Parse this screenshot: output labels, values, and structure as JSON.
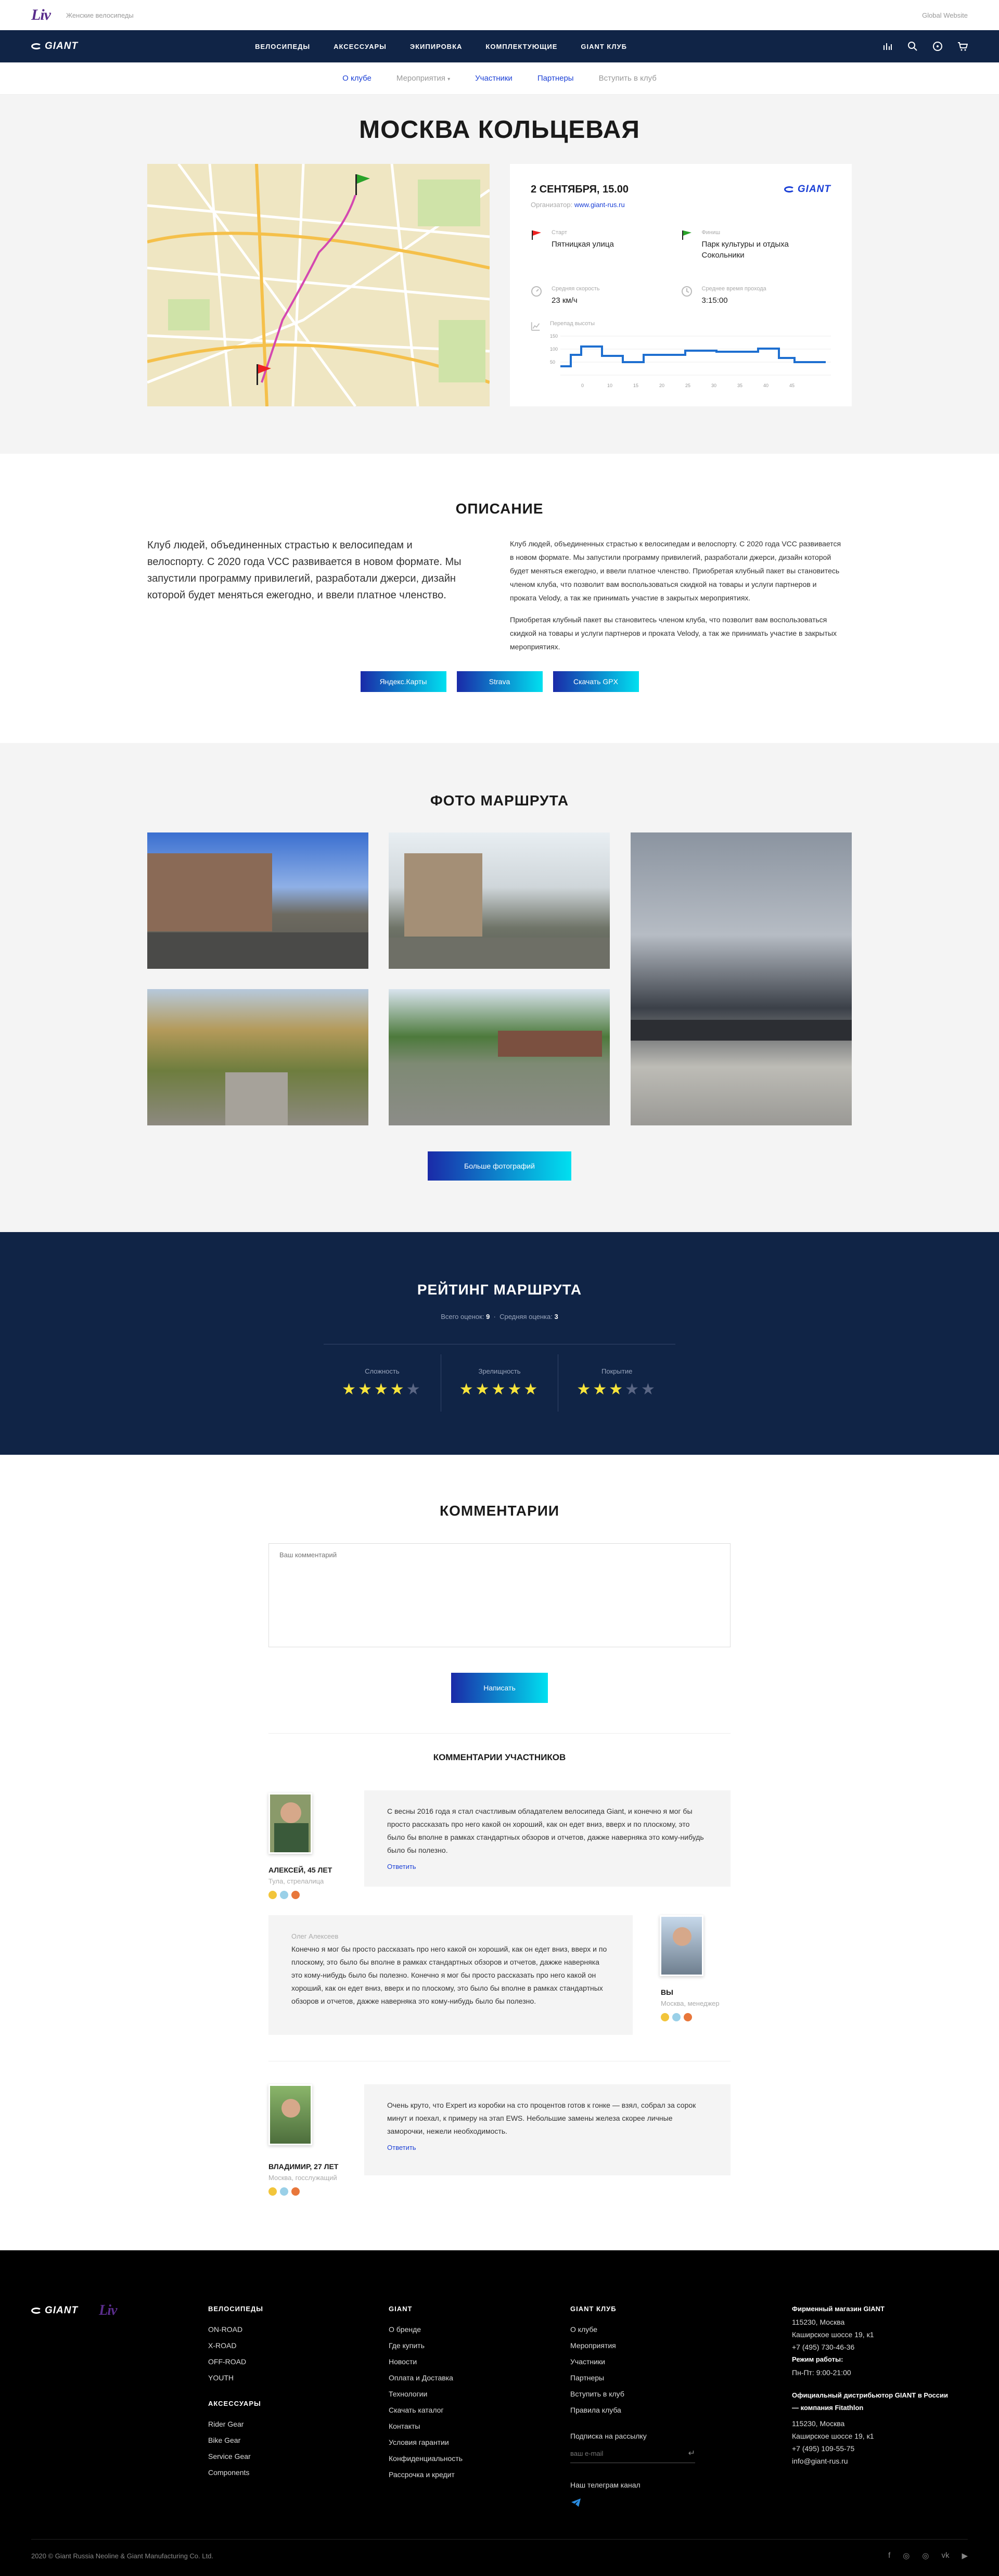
{
  "topbar": {
    "sub_brand": "Женские велосипеды",
    "global": "Global Website"
  },
  "nav": {
    "items": [
      "ВЕЛОСИПЕДЫ",
      "АКСЕССУАРЫ",
      "ЭКИПИРОВКА",
      "КОМПЛЕКТУЮЩИЕ",
      "GIANT КЛУБ"
    ]
  },
  "subnav": {
    "items": [
      "О клубе",
      "Мероприятия",
      "Участники",
      "Партнеры",
      "Вступить в клуб"
    ]
  },
  "route": {
    "title": "МОСКВА КОЛЬЦЕВАЯ",
    "date": "2 СЕНТЯБРЯ, 15.00",
    "organizer_label": "Организатор:",
    "organizer_link": "www.giant-rus.ru",
    "start_label": "Старт",
    "start": "Пятницкая улица",
    "finish_label": "Финиш",
    "finish": "Парк культуры и отдыха Сокольники",
    "speed_label": "Средняя скорость",
    "speed": "23 км/ч",
    "time_label": "Среднее время прохода",
    "time": "3:15:00",
    "elevation_label": "Перепад высоты",
    "elev_y_ticks": [
      "150",
      "100",
      "50"
    ],
    "elev_x_ticks": [
      "0",
      "10",
      "15",
      "20",
      "25",
      "30",
      "35",
      "40",
      "45"
    ]
  },
  "description": {
    "title": "ОПИСАНИЕ",
    "lead": "Клуб людей, объединенных страстью к велосипедам и велоспорту. С 2020 года VCC развивается в новом формате. Мы запустили программу привилегий, разработали джерси, дизайн которой будет меняться ежегодно, и ввели платное членство.",
    "p1": "Клуб людей, объединенных страстью к велосипедам и велоспорту. С 2020 года VCC развивается в новом формате. Мы запустили программу привилегий, разработали джерси, дизайн которой будет меняться ежегодно, и ввели платное членство. Приобретая клубный пакет вы становитесь членом клуба, что позволит вам воспользоваться скидкой на товары и услуги партнеров и проката Velody, а так же принимать участие в закрытых мероприятиях.",
    "p2": "Приобретая клубный пакет вы становитесь членом клуба, что позволит вам воспользоваться скидкой на товары и услуги партнеров и проката Velody, а так же принимать участие в закрытых мероприятиях.",
    "buttons": [
      "Яндекс.Карты",
      "Strava",
      "Скачать GPX"
    ]
  },
  "photos": {
    "title": "ФОТО МАРШРУТА",
    "more": "Больше фотографий"
  },
  "rating": {
    "title": "РЕЙТИНГ МАРШРУТА",
    "total_label": "Всего оценок:",
    "total": "9",
    "avg_label": "Средняя оценка:",
    "avg": "3",
    "criteria": [
      {
        "label": "Сложность",
        "stars": 4
      },
      {
        "label": "Зрелищность",
        "stars": 5
      },
      {
        "label": "Покрытие",
        "stars": 3
      }
    ]
  },
  "comments": {
    "title": "КОММЕНТАРИИ",
    "placeholder": "Ваш комментарий",
    "submit": "Написать",
    "list_title": "КОММЕНТАРИИ УЧАСТНИКОВ",
    "reply": "Ответить",
    "items": [
      {
        "name": "АЛЕКСЕЙ, 45 ЛЕТ",
        "sub": "Тула, стрелалица",
        "text": "С весны 2016 года я стал счастливым обладателем велосипеда Giant, и конечно я мог бы просто рассказать про него какой он хороший, как он едет вниз, вверх и по плоскому, это было бы вполне в рамках стандартных обзоров и отчетов, дажже наверняка это кому-нибудь было бы полезно."
      },
      {
        "name": "ВЫ",
        "sub": "Москва, менеджер",
        "quote": "Олег Алексеев",
        "text": "Конечно я мог бы просто рассказать про него какой он хороший, как он едет вниз, вверх и по плоскому, это было бы вполне в рамках стандартных обзоров и отчетов, дажже наверняка это кому-нибудь было бы полезно. Конечно я мог бы просто рассказать про него какой он хороший, как он едет вниз, вверх и по плоскому, это было бы вполне в рамках стандартных обзоров и отчетов, дажже наверняка это кому-нибудь было бы полезно."
      },
      {
        "name": "ВЛАДИМИР, 27 ЛЕТ",
        "sub": "Москва, госслужащий",
        "text": "Очень круто, что Expert из коробки на сто процентов готов к гонке — взял, собрал за сорок минут и поехал, к примеру на этап EWS. Небольшие замены железа скорее личные заморочки, нежели необходимость."
      }
    ]
  },
  "footer": {
    "bikes_title": "ВЕЛОСИПЕДЫ",
    "bikes": [
      "ON-ROAD",
      "X-ROAD",
      "OFF-ROAD",
      "YOUTH"
    ],
    "acc_title": "АКСЕССУАРЫ",
    "acc": [
      "Rider Gear",
      "Bike Gear",
      "Service Gear",
      "Components"
    ],
    "giant_title": "GIANT",
    "giant": [
      "О бренде",
      "Где купить",
      "Новости",
      "Оплата и Доставка",
      "Технологии",
      "Скачать каталог",
      "Контакты",
      "Условия гарантии",
      "Конфиденциальность",
      "Рассрочка и кредит"
    ],
    "club_title": "GIANT КЛУБ",
    "club": [
      "О клубе",
      "Мероприятия",
      "Участники",
      "Партнеры",
      "Вступить в клуб",
      "Правила клуба"
    ],
    "subscribe": "Подписка на рассылку",
    "email_placeholder": "ваш e-mail",
    "telegram": "Наш телеграм канал",
    "shop_title": "Фирменный магазин GIANT",
    "shop_addr": [
      "115230, Москва",
      "Каширское шоссе 19, к1",
      "+7 (495) 730-46-36"
    ],
    "hours_title": "Режим работы:",
    "hours": "Пн-Пт: 9:00-21:00",
    "dist_title": "Официальный дистрибьютор GIANT в России — компания Fitathlon",
    "dist_addr": [
      "115230, Москва",
      "Каширское шоссе 19, к1",
      "+7 (495) 109-55-75",
      "info@giant-rus.ru"
    ],
    "copyright": "2020 © Giant Russia Neoline & Giant Manufacturing Co. Ltd."
  }
}
